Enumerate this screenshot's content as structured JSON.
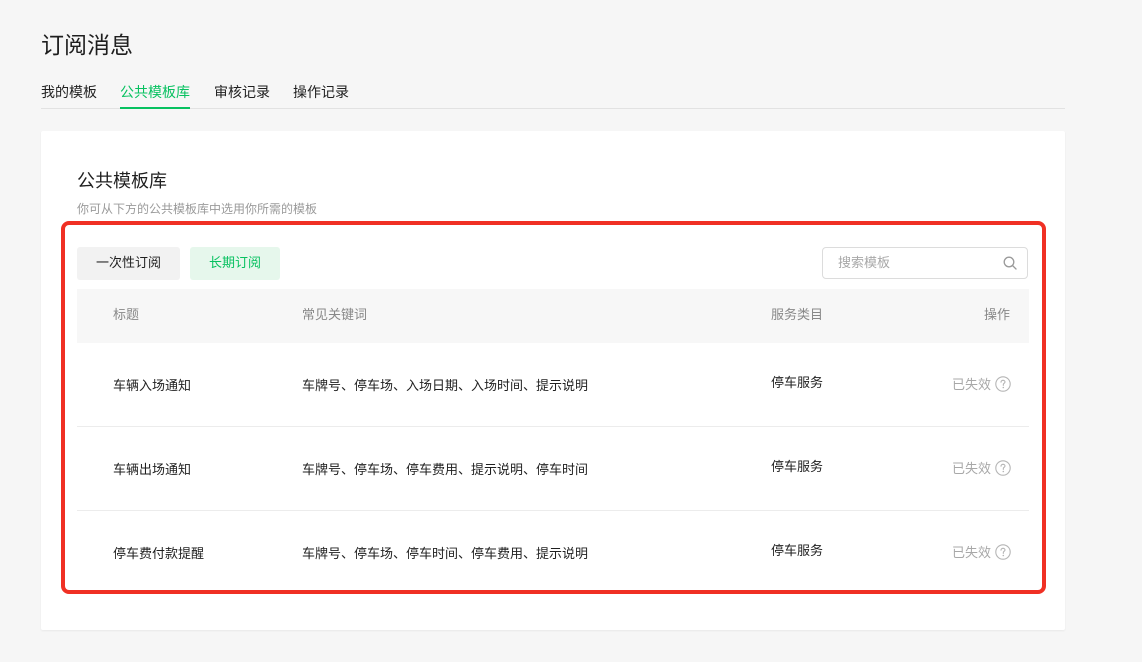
{
  "page": {
    "title": "订阅消息"
  },
  "tabs": [
    {
      "label": "我的模板",
      "active": false
    },
    {
      "label": "公共模板库",
      "active": true
    },
    {
      "label": "审核记录",
      "active": false
    },
    {
      "label": "操作记录",
      "active": false
    }
  ],
  "library": {
    "title": "公共模板库",
    "description": "你可从下方的公共模板库中选用你所需的模板"
  },
  "filters": {
    "once_label": "一次性订阅",
    "long_term_label": "长期订阅",
    "selected": "长期订阅"
  },
  "search": {
    "placeholder": "搜索模板",
    "value": "",
    "icon": "search-icon"
  },
  "table": {
    "headers": {
      "title": "标题",
      "keywords": "常见关键词",
      "category": "服务类目",
      "action": "操作"
    },
    "rows": [
      {
        "title": "车辆入场通知",
        "keywords": "车牌号、停车场、入场日期、入场时间、提示说明",
        "category": "停车服务",
        "status": "已失效",
        "help_icon": "question-circle-icon"
      },
      {
        "title": "车辆出场通知",
        "keywords": "车牌号、停车场、停车费用、提示说明、停车时间",
        "category": "停车服务",
        "status": "已失效",
        "help_icon": "question-circle-icon"
      },
      {
        "title": "停车费付款提醒",
        "keywords": "车牌号、停车场、停车时间、停车费用、提示说明",
        "category": "停车服务",
        "status": "已失效",
        "help_icon": "question-circle-icon"
      }
    ]
  },
  "colors": {
    "accent": "#07c160",
    "accent_bg": "#e6f7ec",
    "highlight_frame": "#f03024",
    "muted_text": "#a8a8a8",
    "page_bg": "#f6f6f6"
  }
}
